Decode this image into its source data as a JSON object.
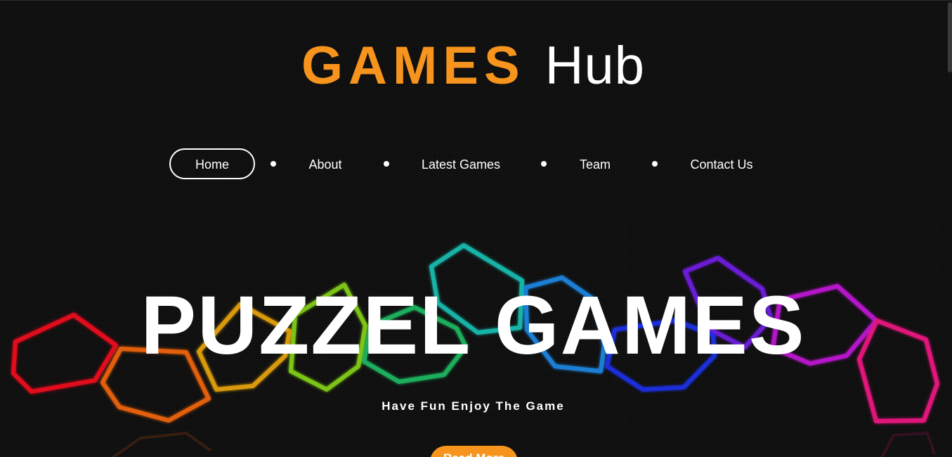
{
  "brand": {
    "games": "GAMES",
    "hub": "Hub",
    "accent_color": "#f7941d"
  },
  "nav": {
    "items": [
      {
        "label": "Home",
        "active": true
      },
      {
        "label": "About",
        "active": false
      },
      {
        "label": "Latest Games",
        "active": false
      },
      {
        "label": "Team",
        "active": false
      },
      {
        "label": "Contact Us",
        "active": false
      }
    ]
  },
  "hero": {
    "title": "PUZZEL GAMES",
    "subtitle": "Have Fun Enjoy The Game",
    "button_label": "Read More",
    "background": "neon-hexagon-chain"
  },
  "colors": {
    "background": "#0d0d0d",
    "hexagons": [
      "#e0101a",
      "#e25f0f",
      "#d99a0a",
      "#7cc414",
      "#1fae5c",
      "#14b3a6",
      "#1a7fd6",
      "#1a2fd9",
      "#6b1fd6",
      "#b516c9",
      "#e0157a"
    ]
  }
}
